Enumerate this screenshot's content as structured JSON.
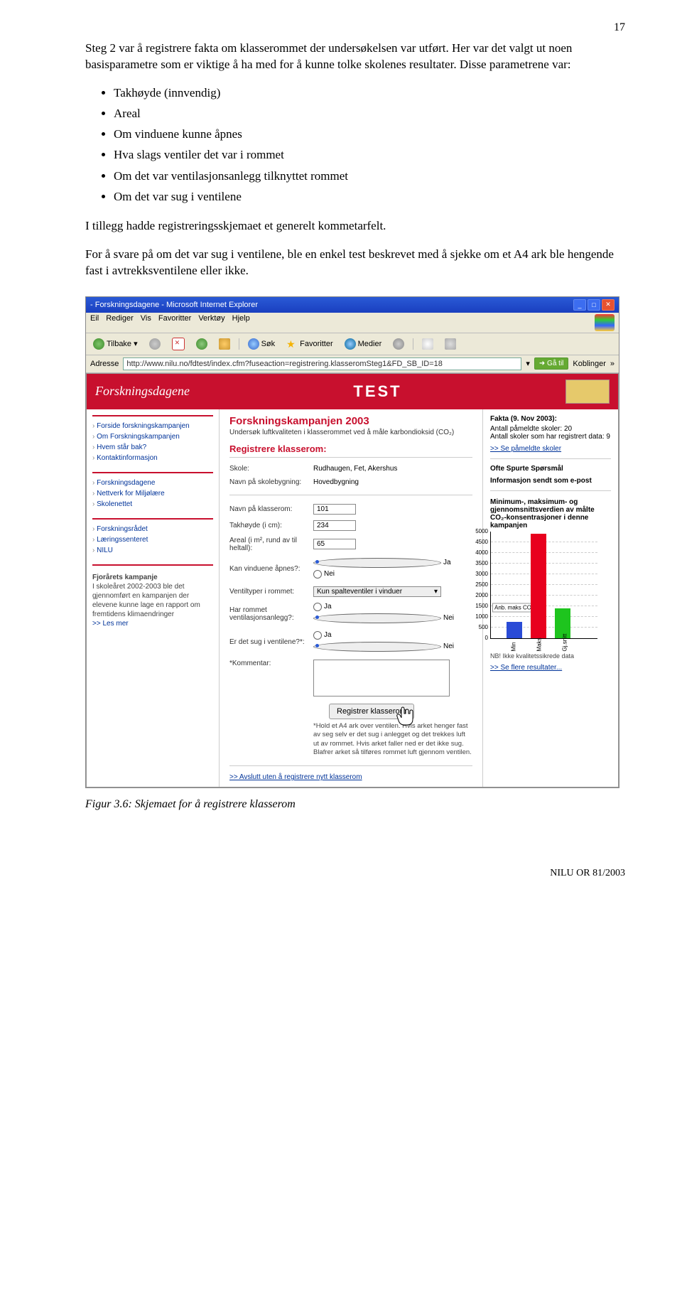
{
  "page_number": "17",
  "para1": "Steg 2 var å registrere fakta om klasserommet der undersøkelsen var utført. Her var det valgt ut noen basisparametre som er viktige å ha med for å kunne tolke skolenes resultater. Disse parametrene var:",
  "bullets": [
    "Takhøyde (innvendig)",
    "Areal",
    "Om vinduene kunne åpnes",
    "Hva slags ventiler det var i rommet",
    "Om det var ventilasjonsanlegg tilknyttet rommet",
    "Om det var sug i ventilene"
  ],
  "para2": "I tillegg hadde registreringsskjemaet et generelt kommetarfelt.",
  "para3": "For å svare på om det var sug i ventilene, ble en enkel test beskrevet med å sjekke om et A4 ark ble hengende fast i avtrekksventilene eller ikke.",
  "browser": {
    "title": " - Forskningsdagene - Microsoft Internet Explorer",
    "menus": [
      "Eil",
      "Rediger",
      "Vis",
      "Favoritter",
      "Verktøy",
      "Hjelp"
    ],
    "back": "Tilbake",
    "search": "Søk",
    "favorites": "Favoritter",
    "media": "Medier",
    "addr_label": "Adresse",
    "url": "http://www.nilu.no/fdtest/index.cfm?fuseaction=registrering.klasseromSteg1&FD_SB_ID=18",
    "go": "Gå til",
    "links": "Koblinger"
  },
  "site": {
    "logo": "Forskningsdagene",
    "test": "TEST",
    "nav1": [
      "Forside forskningskampanjen",
      "Om Forskningskampanjen",
      "Hvem står bak?",
      "Kontaktinformasjon"
    ],
    "nav2": [
      "Forskningsdagene",
      "Nettverk for Miljølære",
      "Skolenettet"
    ],
    "nav3": [
      "Forskningsrådet",
      "Læringssenteret",
      "NILU"
    ],
    "campaign_heading": "Fjorårets kampanje",
    "campaign_text": "I skoleåret 2002-2003 ble det gjennomført en kampanjen der elevene kunne lage en rapport om fremtidens klimaendringer",
    "campaign_link": ">> Les mer"
  },
  "form": {
    "title": "Forskningskampanjen 2003",
    "subtitle": "Undersøk luftkvaliteten i klasserommet ved å måle karbondioksid (CO₂)",
    "heading": "Registrere klasserom:",
    "skole_lbl": "Skole:",
    "skole_val": "Rudhaugen, Fet, Akershus",
    "bygning_lbl": "Navn på skolebygning:",
    "bygning_val": "Hovedbygning",
    "klasserom_lbl": "Navn på klasserom:",
    "klasserom_val": "101",
    "takhoyde_lbl": "Takhøyde (i cm):",
    "takhoyde_val": "234",
    "areal_lbl": "Areal (i m², rund av til heltall):",
    "areal_val": "65",
    "vinduer_lbl": "Kan vinduene åpnes?:",
    "ja": "Ja",
    "nei": "Nei",
    "ventiltyper_lbl": "Ventiltyper i rommet:",
    "ventiltyper_val": "Kun spalteventiler i vinduer",
    "anlegg_lbl": "Har rommet ventilasjonsanlegg?:",
    "sug_lbl": "Er det sug i ventilene?*:",
    "kommentar_lbl": "*Kommentar:",
    "hint": "*Hold et A4 ark over ventilen. Hvis arket henger fast av seg selv er det sug i anlegget og det trekkes luft ut av rommet. Hvis arket faller ned er det ikke sug. Blafrer arket så tilføres rommet luft gjennom ventilen.",
    "btn": "Registrer klasserom",
    "finish": ">> Avslutt uten å registrere nytt klasserom"
  },
  "right": {
    "fakta_h": "Fakta (9. Nov 2003):",
    "fakta1": "Antall påmeldte skoler: 20",
    "fakta2": "Antall skoler som har registrert data: 9",
    "link1": ">> Se påmeldte skoler",
    "ofte_h": "Ofte Spurte Spørsmål",
    "info_h": "Informasjon sendt som e-post",
    "stats_h": "Minimum-, maksimum- og gjennomsnittsverdien av målte CO₂-konsentrasjoner i denne kampanjen",
    "anb": "Anb. maks CO2",
    "x_min": "Min",
    "x_maks": "Maks",
    "x_gj": "Gj.snitt",
    "nb": "NB! Ikke kvalitetssikrede data",
    "link2": ">> Se flere resultater..."
  },
  "chart_data": {
    "type": "bar",
    "categories": [
      "Min",
      "Maks",
      "Gj.snitt"
    ],
    "values": [
      500,
      5000,
      1400
    ],
    "yticks": [
      0,
      500,
      1000,
      1500,
      2000,
      2500,
      3000,
      3500,
      4000,
      4500,
      5000
    ],
    "ylim": [
      0,
      5000
    ],
    "annotation": {
      "label": "Anb. maks CO2",
      "y": 1000
    },
    "title": "Minimum-, maksimum- og gjennomsnittsverdien av målte CO₂-konsentrasjoner i denne kampanjen"
  },
  "figure_caption": "Figur 3.6:  Skjemaet for å registrere klasserom",
  "footer": "NILU OR 81/2003"
}
